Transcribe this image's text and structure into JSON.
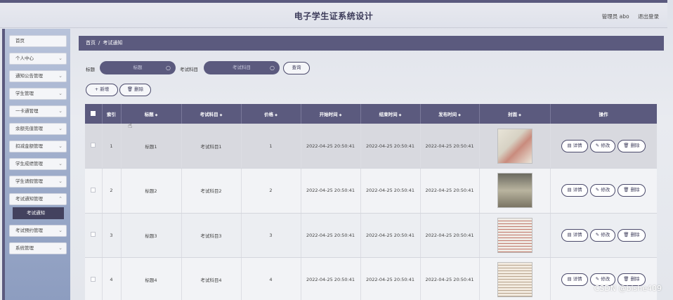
{
  "header": {
    "title": "电子学生证系统设计",
    "user_label": "管理员 abo",
    "logout_label": "退出登录"
  },
  "sidebar": {
    "items": [
      {
        "label": "首页",
        "has_chevron": false
      },
      {
        "label": "个人中心",
        "has_chevron": true
      },
      {
        "label": "通知公告管理",
        "has_chevron": true
      },
      {
        "label": "学生管理",
        "has_chevron": true
      },
      {
        "label": "一卡通管理",
        "has_chevron": true
      },
      {
        "label": "余额充值管理",
        "has_chevron": true
      },
      {
        "label": "扣减金额管理",
        "has_chevron": true
      },
      {
        "label": "学生成绩管理",
        "has_chevron": true
      },
      {
        "label": "学生请假管理",
        "has_chevron": true
      },
      {
        "label": "考试通知管理",
        "has_chevron": true
      }
    ],
    "active_sub": "考试通知",
    "items_after": [
      {
        "label": "考试预约管理",
        "has_chevron": true
      },
      {
        "label": "系统管理",
        "has_chevron": true
      }
    ]
  },
  "breadcrumb": {
    "home": "首页",
    "separator": "/",
    "current": "考试通知"
  },
  "search": {
    "title_label": "标题",
    "title_placeholder": "标题",
    "subject_label": "考试科目",
    "subject_placeholder": "考试科目",
    "query_button": "查询"
  },
  "toolbar": {
    "add_label": "+ 新增",
    "delete_label": "删除"
  },
  "table": {
    "columns": [
      "索引",
      "标题",
      "考试科目",
      "价格",
      "开始时间",
      "结束时间",
      "发布时间",
      "封面",
      "操作"
    ],
    "sortable": [
      false,
      true,
      true,
      true,
      true,
      true,
      true,
      true,
      false
    ],
    "rows": [
      {
        "index": "1",
        "title": "标题1",
        "subject": "考试科目1",
        "price": "1",
        "start": "2022-04-25 20:50:41",
        "end": "2022-04-25 20:50:41",
        "published": "2022-04-25 20:50:41"
      },
      {
        "index": "2",
        "title": "标题2",
        "subject": "考试科目2",
        "price": "2",
        "start": "2022-04-25 20:50:41",
        "end": "2022-04-25 20:50:41",
        "published": "2022-04-25 20:50:41"
      },
      {
        "index": "3",
        "title": "标题3",
        "subject": "考试科目3",
        "price": "3",
        "start": "2022-04-25 20:50:41",
        "end": "2022-04-25 20:50:41",
        "published": "2022-04-25 20:50:41"
      },
      {
        "index": "4",
        "title": "标题4",
        "subject": "考试科目4",
        "price": "4",
        "start": "2022-04-25 20:50:41",
        "end": "2022-04-25 20:50:41",
        "published": "2022-04-25 20:50:41"
      }
    ],
    "actions": {
      "detail": "详情",
      "edit": "修改",
      "delete": "删除"
    }
  },
  "watermark": "CSDN @bishe409",
  "colors": {
    "primary": "#5b5a7e",
    "sidebar_active": "#43425f"
  }
}
